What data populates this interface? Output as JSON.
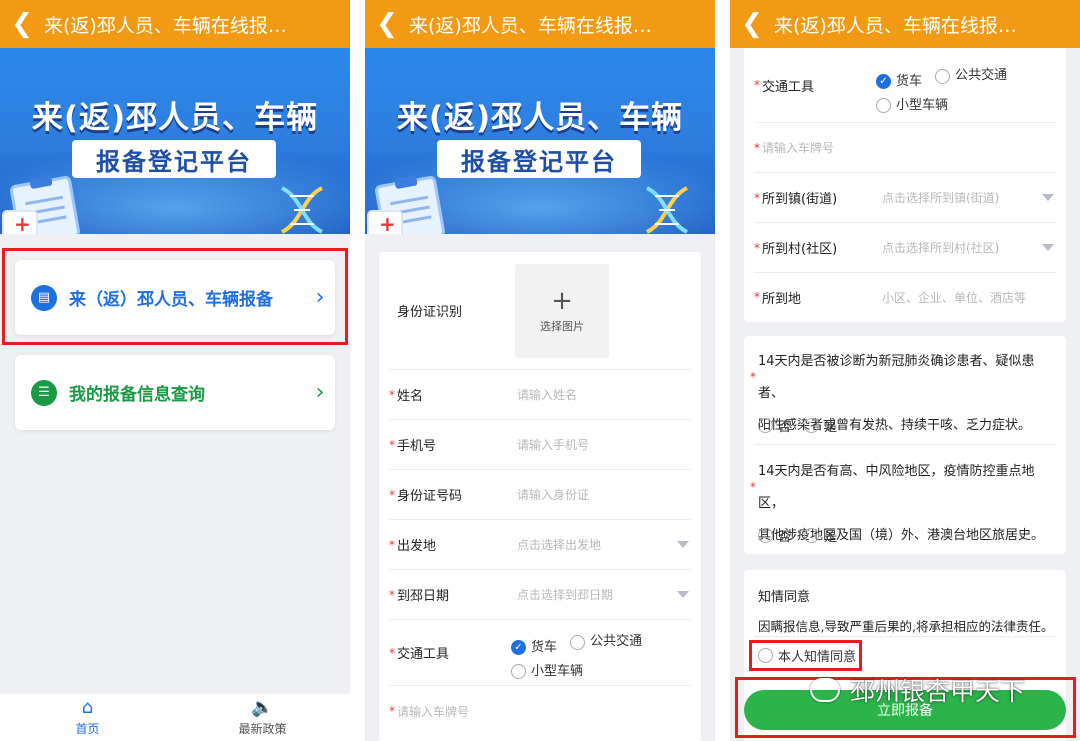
{
  "header": {
    "title": "来(返)邳人员、车辆在线报…",
    "back_icon": "chevron-left-icon"
  },
  "banner": {
    "line1": "来(返)邳人员、车辆",
    "line2": "报备登记平台"
  },
  "home": {
    "cards": [
      {
        "label": "来（返）邳人员、车辆报备",
        "color": "#1e6fe0",
        "icon": "document-icon"
      },
      {
        "label": "我的报备信息查询",
        "color": "#1a9a45",
        "icon": "list-icon"
      }
    ],
    "tabbar": [
      {
        "label": "首页",
        "icon": "home-icon",
        "active": true
      },
      {
        "label": "最新政策",
        "icon": "speaker-icon",
        "active": false
      }
    ]
  },
  "form": {
    "id_recognition": {
      "label": "身份证识别",
      "upload_plus": "+",
      "upload_text": "选择图片"
    },
    "name": {
      "label": "姓名",
      "placeholder": "请输入姓名"
    },
    "phone": {
      "label": "手机号",
      "placeholder": "请输入手机号"
    },
    "id_number": {
      "label": "身份证号码",
      "placeholder": "请输入身份证"
    },
    "origin": {
      "label": "出发地",
      "placeholder": "点击选择出发地"
    },
    "arrival_date": {
      "label": "到邳日期",
      "placeholder": "点击选择到邳日期"
    },
    "transport": {
      "label": "交通工具",
      "options": [
        "货车",
        "公共交通",
        "小型车辆"
      ],
      "selected": "货车"
    },
    "plate": {
      "placeholder": "请输入车牌号"
    },
    "town": {
      "label": "所到镇(街道)",
      "placeholder": "点击选择所到镇(街道)"
    },
    "village": {
      "label": "所到村(社区)",
      "placeholder": "点击选择所到村(社区)"
    },
    "destination": {
      "label": "所到地",
      "placeholder": "小区、企业、单位、酒店等"
    },
    "q1": {
      "line1": "14天内是否被诊断为新冠肺炎确诊患者、疑似患者、",
      "line2": "阳性感染者或曾有发热、持续干咳、乏力症状。",
      "no": "否",
      "yes": "是"
    },
    "q2": {
      "line1": "14天内是否有高、中风险地区，疫情防控重点地区，",
      "line2": "其他涉疫地区及国（境）外、港澳台地区旅居史。",
      "no": "否",
      "yes": "是"
    },
    "consent": {
      "title": "知情同意",
      "text": "因瞒报信息,导致严重后果的,将承担相应的法律责任。",
      "checkbox": "本人知情同意"
    },
    "submit": "立即报备"
  },
  "watermark": "邳州银杏甲天下",
  "highlight_color": "#e81c1c",
  "accent_color": "#1e6fe0",
  "header_color": "#f39a15"
}
